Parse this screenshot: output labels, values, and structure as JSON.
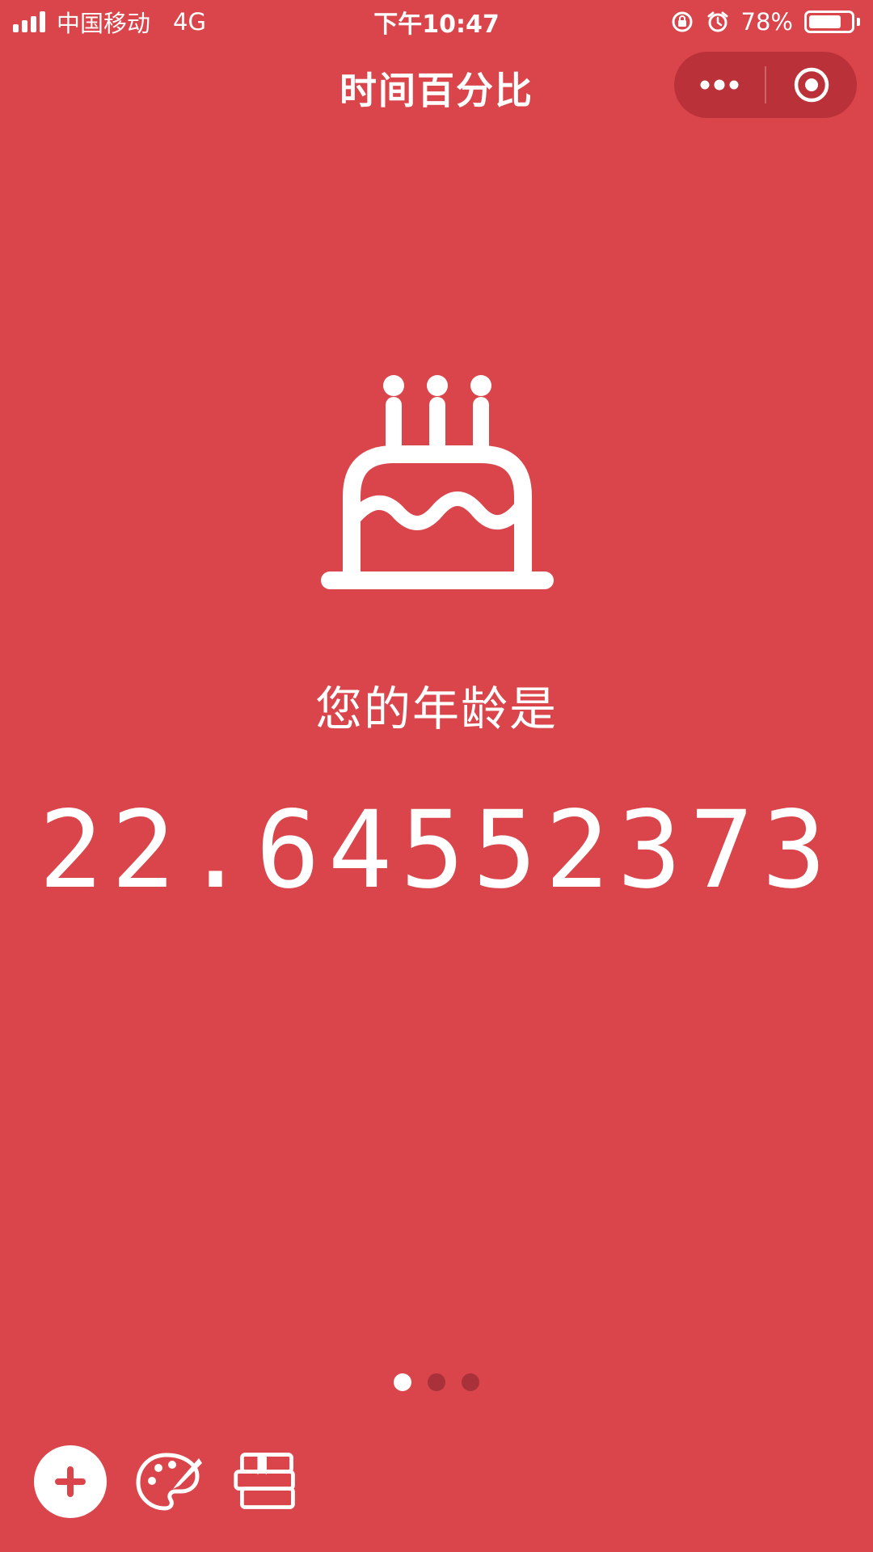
{
  "status_bar": {
    "carrier": "中国移动",
    "network": "4G",
    "time": "下午10:47",
    "battery": "78%",
    "battery_level": 0.78
  },
  "nav": {
    "title": "时间百分比"
  },
  "main": {
    "icon": "birthday-cake-icon",
    "label": "您的年龄是",
    "value": "22.64552373"
  },
  "pager": {
    "count": 3,
    "active_index": 0
  },
  "toolbar": {
    "icons": [
      "add-icon",
      "palette-icon",
      "books-icon"
    ]
  },
  "colors": {
    "background": "#d9454b",
    "accent": "#ffffff",
    "inactive_dot": "#a8313a"
  }
}
